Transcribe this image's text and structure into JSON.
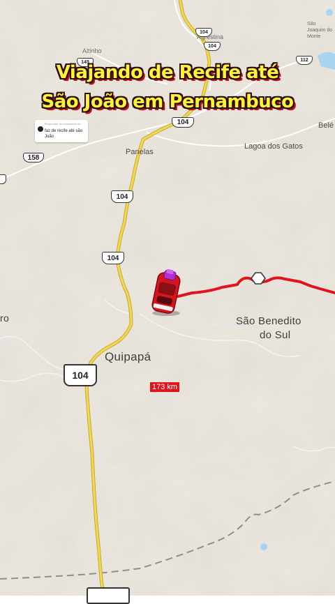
{
  "title": {
    "line1": "Viajando de Recife até",
    "line2": "São João em Pernambuco"
  },
  "comment_reply": {
    "header": "Responder ao comentário de",
    "text": "faz de recife até são João"
  },
  "places": {
    "altinho": "Altinho",
    "agrestina": "Agrestina",
    "sao_joaquim": "São Joaquim do Monte",
    "panelas": "Panelas",
    "lagoa_dos_gatos": "Lagoa dos Gatos",
    "bele": "Belé",
    "ro": "ro",
    "sao_benedito_line1": "São Benedito",
    "sao_benedito_line2": "do Sul",
    "quipapa": "Quipapá"
  },
  "road_shields": {
    "r104_a": "104",
    "r104_b": "104",
    "r104_c": "104",
    "r104_d": "104",
    "r104_e": "104",
    "r104_f": "104",
    "r158": "158",
    "r112": "112",
    "r145": "145"
  },
  "route": {
    "distance_label": "173 km",
    "color": "#e0141e"
  },
  "vehicle": {
    "icon": "red-car-icon"
  },
  "colors": {
    "map_background": "#ede8df",
    "road_highway": "#f3d84b",
    "water": "#a9d4f1",
    "title_text": "#fff23a"
  }
}
